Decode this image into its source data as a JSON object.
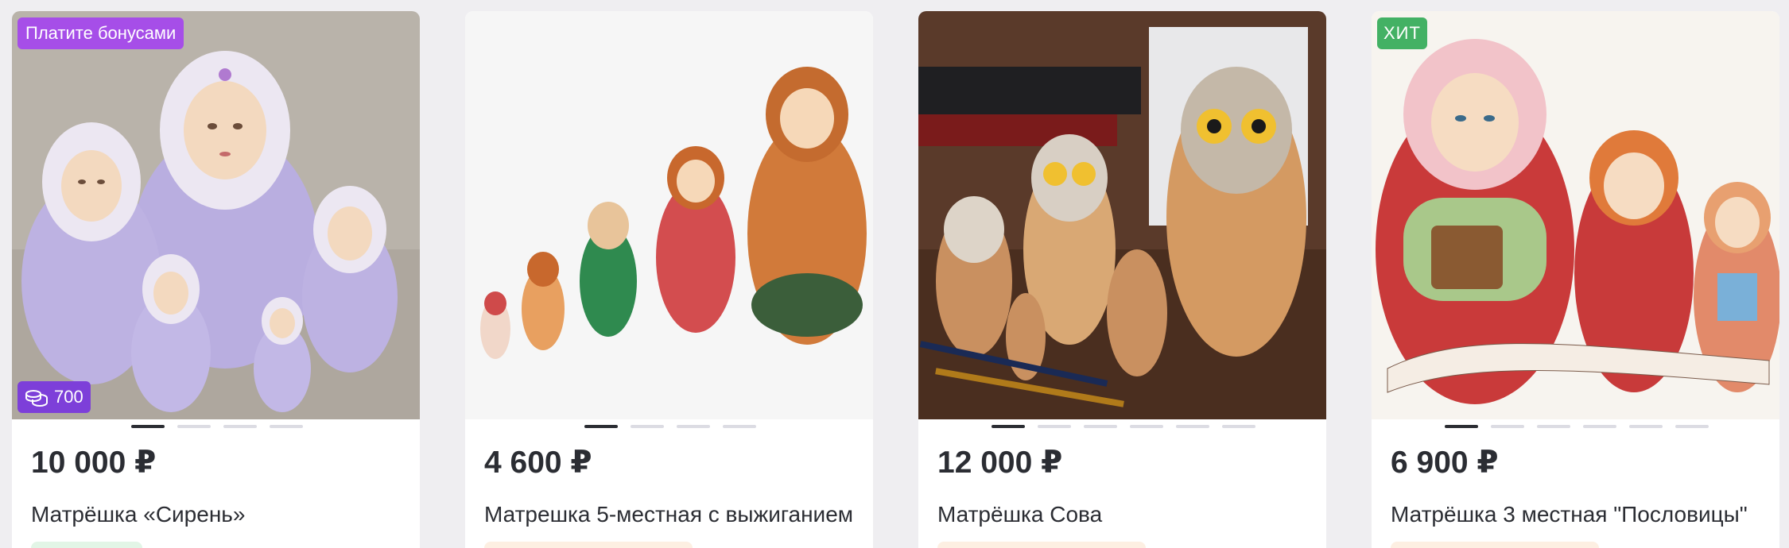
{
  "products": [
    {
      "price": "10 000 ₽",
      "title": "Матрёшка «Сирень»",
      "badge_top": "Платите бонусами",
      "bonus_coins": "700",
      "coin_icon": "coins-stack-icon",
      "dots": 4,
      "active_dot": 0,
      "tag_color": "#e2f5e6"
    },
    {
      "price": "4 600 ₽",
      "title": "Матрешка 5-местная с выжиганием",
      "dots": 4,
      "active_dot": 0,
      "tag_color": "#fdefe2"
    },
    {
      "price": "12 000 ₽",
      "title": "Матрёшка Сова",
      "dots": 6,
      "active_dot": 0,
      "tag_color": "#fdefe2"
    },
    {
      "price": "6 900 ₽",
      "title": "Матрёшка 3 местная \"Пословицы\"",
      "badge_top": "ХИТ",
      "dots": 6,
      "active_dot": 0,
      "tag_color": "#fdefe2"
    }
  ],
  "colors": {
    "bonus_badge": "#a64ee8",
    "coins_badge": "#7d3fd9",
    "hit_badge": "#43b164",
    "page_bg": "#efeef1"
  }
}
